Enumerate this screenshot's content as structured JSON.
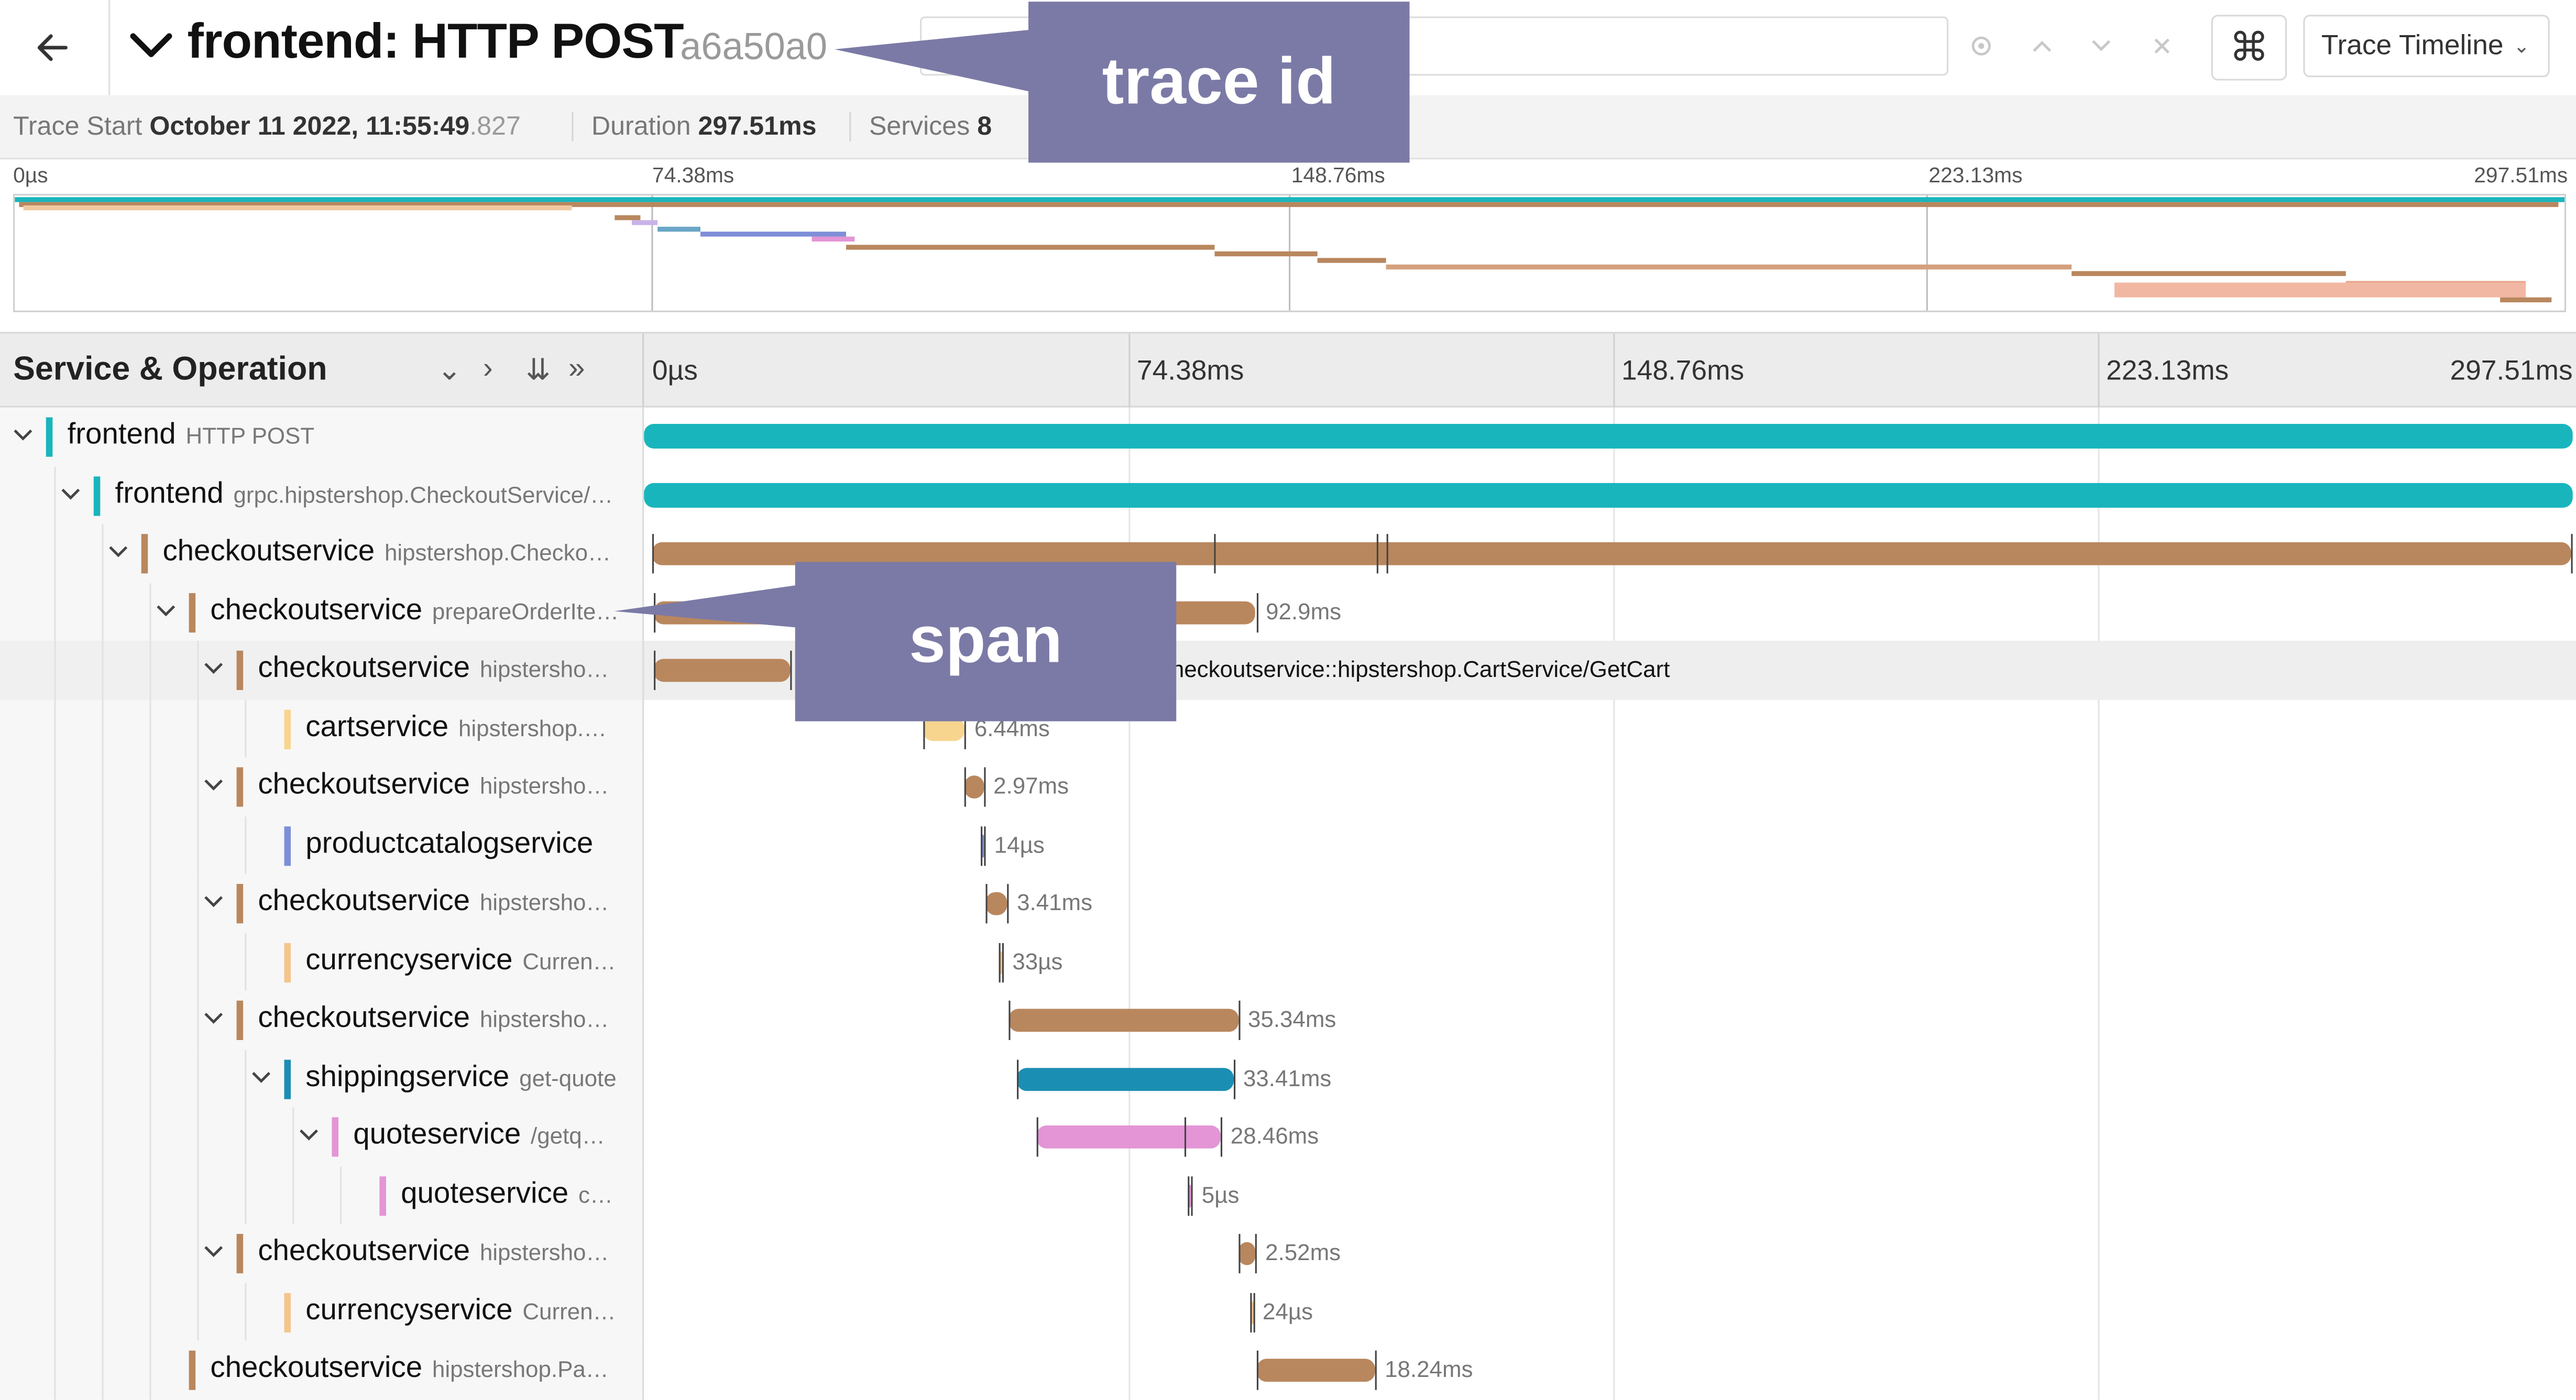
{
  "header": {
    "title": "frontend: HTTP POST",
    "trace_id": "a6a50a0",
    "search_placeholder": "",
    "keyboard_icon": "⌘",
    "view_select": "Trace Timeline"
  },
  "summary": {
    "trace_start_label": "Trace Start",
    "trace_start_value": "October 11 2022, 11:55:49",
    "trace_start_ms": ".827",
    "duration_label": "Duration",
    "duration_value": "297.51ms",
    "services_label": "Services",
    "services_value": "8"
  },
  "timeline_ticks": [
    "0µs",
    "74.38ms",
    "148.76ms",
    "223.13ms",
    "297.51ms"
  ],
  "detail": {
    "column_title": "Service & Operation"
  },
  "colors": {
    "frontend": "#19b5bd",
    "checkoutservice": "#b9875e",
    "cartservice": "#f7d58f",
    "productcatalogservice": "#7e8fd8",
    "currencyservice": "#f4c58c",
    "shippingservice": "#1b8fb3",
    "quoteservice": "#e395d6"
  },
  "rows": [
    {
      "service": "frontend",
      "operation": "HTTP POST",
      "svc_color": "#19b5bd",
      "bar_color": "#19b5bd",
      "start_ms": 0,
      "duration_ms": 297.51,
      "label": ""
    },
    {
      "service": "frontend",
      "operation": "grpc.hipstershop.CheckoutService/…",
      "svc_color": "#19b5bd",
      "bar_color": "#19b5bd",
      "start_ms": 0,
      "duration_ms": 297.4,
      "label": ""
    },
    {
      "service": "checkoutservice",
      "operation": "hipstershop.Checko…",
      "svc_color": "#b9875e",
      "bar_color": "#b9875e",
      "start_ms": 1.2,
      "duration_ms": 296.1,
      "label": ""
    },
    {
      "service": "checkoutservice",
      "operation": "prepareOrderIte…",
      "svc_color": "#b9875e",
      "bar_color": "#b9875e",
      "start_ms": 1.5,
      "duration_ms": 92.9,
      "label": "92.9ms"
    },
    {
      "service": "checkoutservice",
      "operation": "hipstersho…",
      "svc_color": "#b9875e",
      "bar_color": "#b9875e",
      "start_ms": 1.6,
      "duration_ms": 21.0,
      "label": "checkoutservice::hipstershop.CartService/GetCart"
    },
    {
      "service": "cartservice",
      "operation": "hipstershop.…",
      "svc_color": "#f7d58f",
      "bar_color": "#f7d58f",
      "start_ms": 43.0,
      "duration_ms": 6.44,
      "label": "6.44ms"
    },
    {
      "service": "checkoutservice",
      "operation": "hipstersho…",
      "svc_color": "#b9875e",
      "bar_color": "#b9875e",
      "start_ms": 49.4,
      "duration_ms": 2.97,
      "label": "2.97ms"
    },
    {
      "service": "productcatalogservice",
      "operation": "",
      "svc_color": "#7e8fd8",
      "bar_color": "#7e8fd8",
      "start_ms": 52.0,
      "duration_ms": 0.014,
      "label": "14µs"
    },
    {
      "service": "checkoutservice",
      "operation": "hipstersho…",
      "svc_color": "#b9875e",
      "bar_color": "#b9875e",
      "start_ms": 52.6,
      "duration_ms": 3.41,
      "label": "3.41ms"
    },
    {
      "service": "currencyservice",
      "operation": "Curren…",
      "svc_color": "#f4c58c",
      "bar_color": "#f4c58c",
      "start_ms": 54.8,
      "duration_ms": 0.033,
      "label": "33µs"
    },
    {
      "service": "checkoutservice",
      "operation": "hipstersho…",
      "svc_color": "#b9875e",
      "bar_color": "#b9875e",
      "start_ms": 56.3,
      "duration_ms": 35.34,
      "label": "35.34ms"
    },
    {
      "service": "shippingservice",
      "operation": "get-quote",
      "svc_color": "#1b8fb3",
      "bar_color": "#1b8fb3",
      "start_ms": 57.5,
      "duration_ms": 33.41,
      "label": "33.41ms"
    },
    {
      "service": "quoteservice",
      "operation": "/getq…",
      "svc_color": "#e395d6",
      "bar_color": "#e395d6",
      "start_ms": 60.5,
      "duration_ms": 28.46,
      "label": "28.46ms"
    },
    {
      "service": "quoteservice",
      "operation": "c…",
      "svc_color": "#e395d6",
      "bar_color": "#e395d6",
      "start_ms": 84.0,
      "duration_ms": 0.005,
      "label": "5µs"
    },
    {
      "service": "checkoutservice",
      "operation": "hipstersho…",
      "svc_color": "#b9875e",
      "bar_color": "#b9875e",
      "start_ms": 91.8,
      "duration_ms": 2.52,
      "label": "2.52ms"
    },
    {
      "service": "currencyservice",
      "operation": "Curren…",
      "svc_color": "#f4c58c",
      "bar_color": "#f4c58c",
      "start_ms": 93.4,
      "duration_ms": 0.024,
      "label": "24µs"
    },
    {
      "service": "checkoutservice",
      "operation": "hipstershop.Pa…",
      "svc_color": "#b9875e",
      "bar_color": "#b9875e",
      "start_ms": 94.5,
      "duration_ms": 18.24,
      "label": "18.24ms"
    }
  ],
  "callouts": {
    "trace_id": "trace id",
    "span": "span"
  }
}
